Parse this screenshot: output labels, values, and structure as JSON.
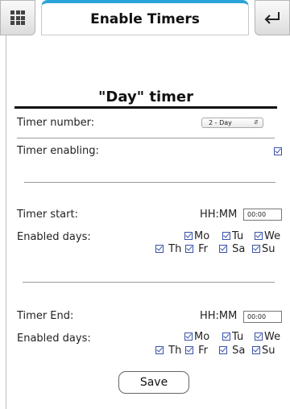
{
  "header": {
    "title": "Enable Timers",
    "menu_icon": "grid-menu-icon",
    "back_icon": "return-arrow-icon"
  },
  "section": {
    "title": "\"Day\" timer"
  },
  "timer_number": {
    "label": "Timer number:",
    "value": "2 - Day"
  },
  "timer_enabling": {
    "label": "Timer enabling:",
    "checked": true
  },
  "start": {
    "label": "Timer start:",
    "time_label": "HH:MM",
    "time_value": "00:00",
    "days_label": "Enabled days:",
    "days": [
      {
        "label": "Mo",
        "checked": true
      },
      {
        "label": "Tu",
        "checked": true
      },
      {
        "label": "We",
        "checked": true
      },
      {
        "label": "Th",
        "checked": true
      },
      {
        "label": "Fr",
        "checked": true
      },
      {
        "label": "Sa",
        "checked": true
      },
      {
        "label": "Su",
        "checked": true
      }
    ]
  },
  "end": {
    "label": "Timer End:",
    "time_label": "HH:MM",
    "time_value": "00:00",
    "days_label": "Enabled days:",
    "days": [
      {
        "label": "Mo",
        "checked": true
      },
      {
        "label": "Tu",
        "checked": true
      },
      {
        "label": "We",
        "checked": true
      },
      {
        "label": "Th",
        "checked": true
      },
      {
        "label": "Fr",
        "checked": true
      },
      {
        "label": "Sa",
        "checked": true
      },
      {
        "label": "Su",
        "checked": true
      }
    ]
  },
  "save_label": "Save",
  "colors": {
    "accent": "#2aa3d8",
    "checkbox": "#3a52a8"
  }
}
